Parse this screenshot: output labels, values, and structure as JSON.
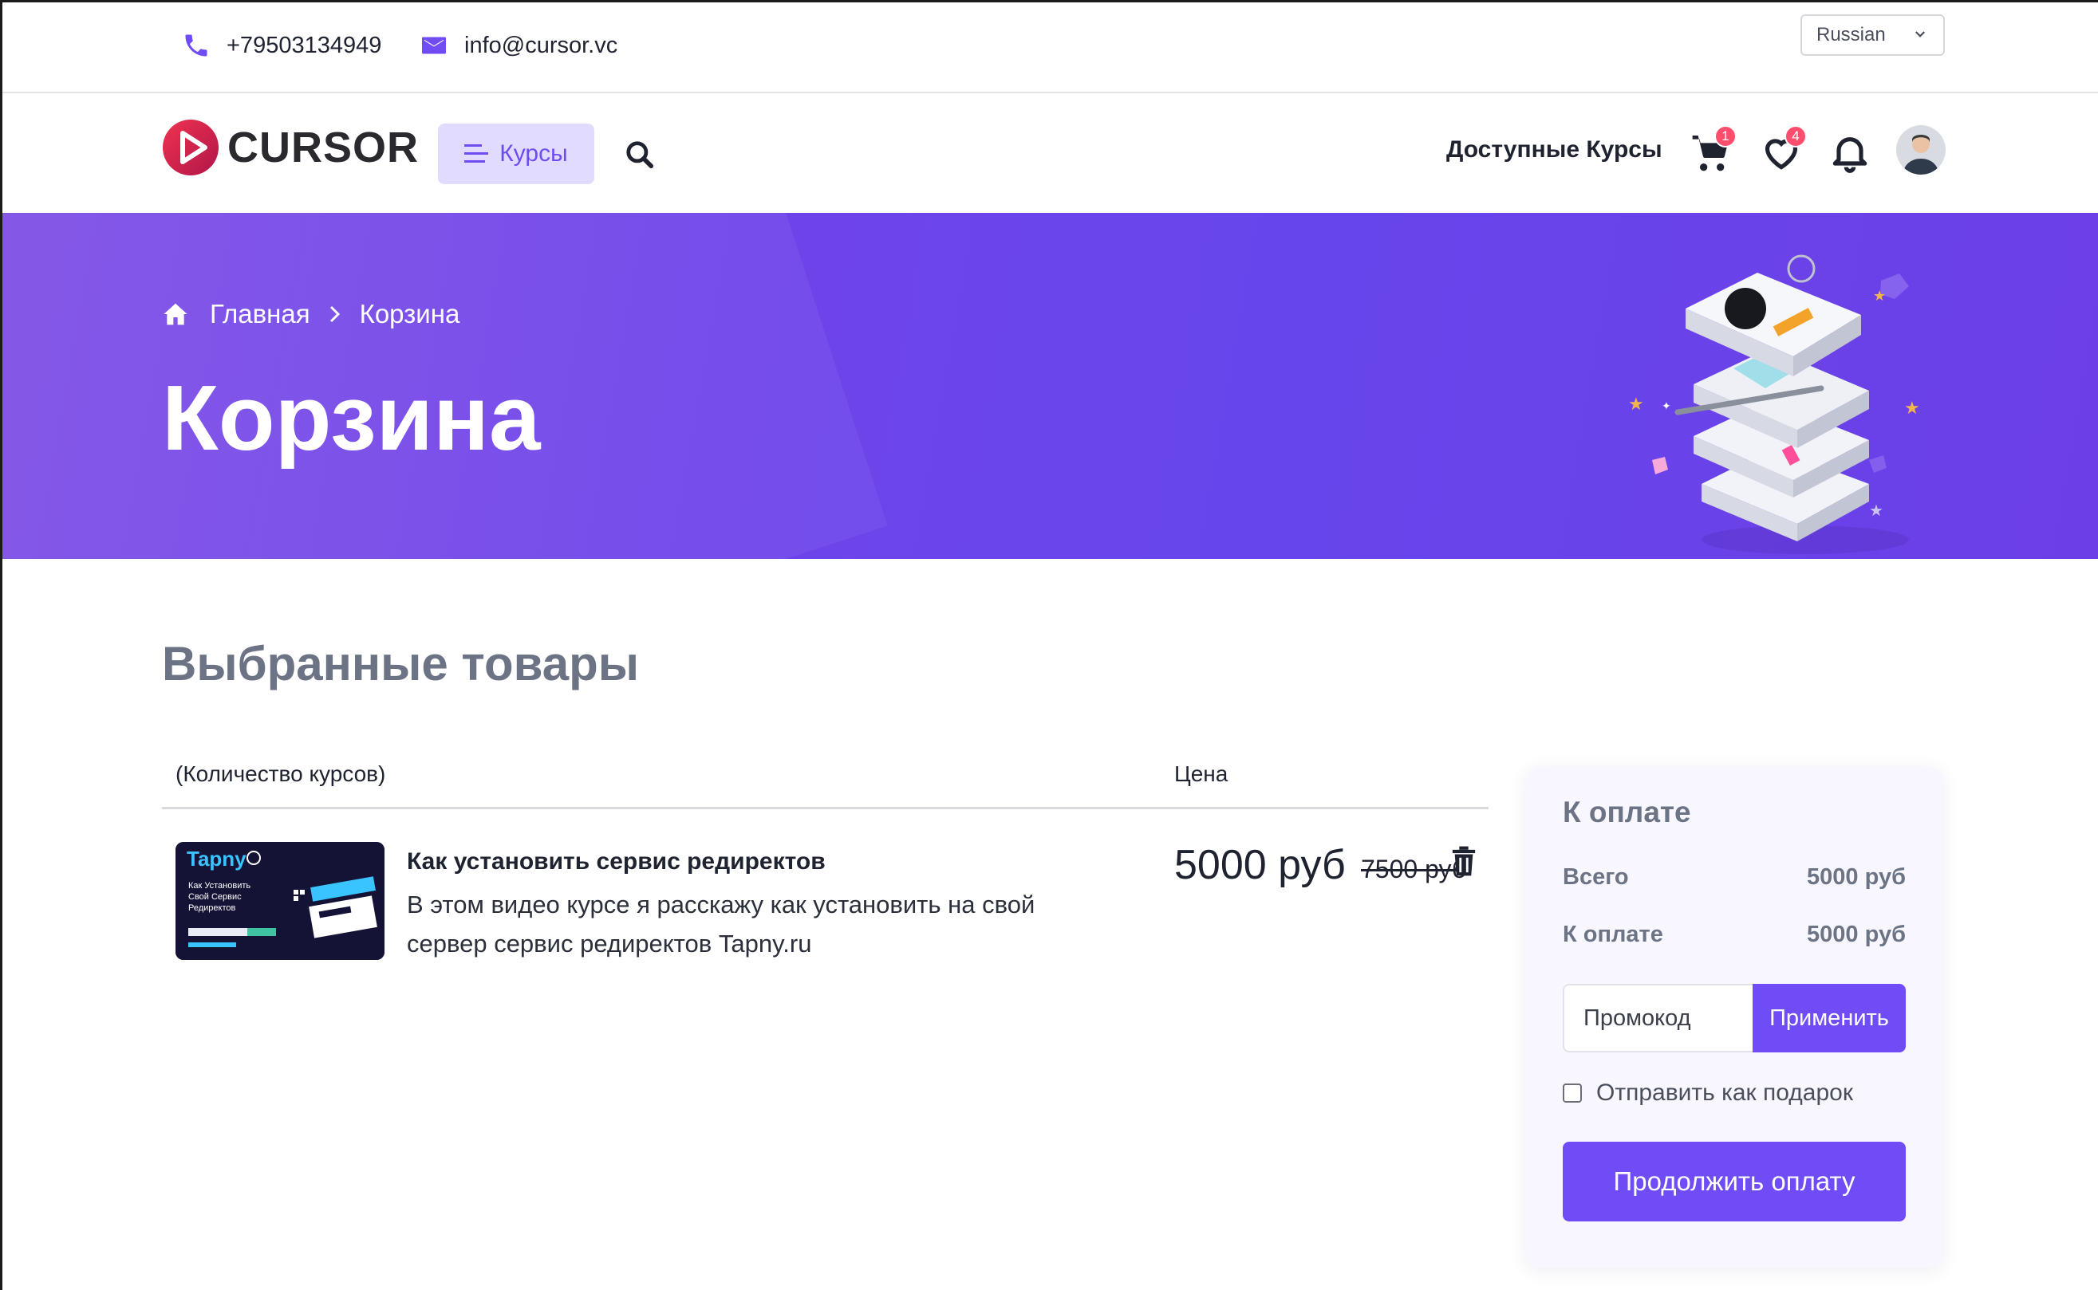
{
  "topbar": {
    "phone": "+79503134949",
    "email": "info@cursor.vc",
    "language": "Russian"
  },
  "nav": {
    "logo_text": "CURSOR",
    "courses_label": "Курсы",
    "available_courses": "Доступные Курсы",
    "cart_count": "1",
    "wishlist_count": "4"
  },
  "banner": {
    "breadcrumb_home": "Главная",
    "breadcrumb_current": "Корзина",
    "title": "Корзина"
  },
  "cart": {
    "section_title": "Выбранные товары",
    "col_quantity": "(Количество курсов)",
    "col_price": "Цена",
    "items": [
      {
        "title": "Как установить сервис редиректов",
        "description": "В этом видео курсе я расскажу как установить на свой сервер сервис редиректов Tapny.ru",
        "price": "5000 руб",
        "old_price": "7500 руб",
        "thumb_brand": "Tapny",
        "thumb_text": "Как Установить Свой Сервис Редиректов"
      }
    ]
  },
  "summary": {
    "title": "К оплате",
    "total_label": "Всего",
    "total_value": "5000 руб",
    "due_label": "К оплате",
    "due_value": "5000 руб",
    "promo_placeholder": "Промокод",
    "apply_label": "Применить",
    "gift_label": "Отправить как подарок",
    "gift_checked": false,
    "continue_label": "Продолжить оплату"
  },
  "colors": {
    "accent": "#6f4cf6",
    "banner": "#6c44ea",
    "badge": "#ff4d6d",
    "muted_heading": "#6b7385"
  }
}
